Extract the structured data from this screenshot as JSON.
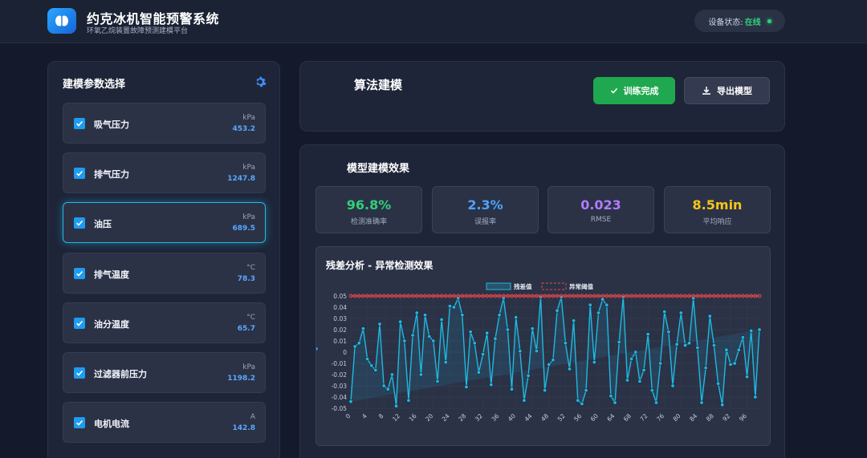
{
  "header": {
    "title": "约克冰机智能预警系统",
    "subtitle": "环氧乙烷装置故障预测建模平台",
    "status_label": "设备状态:",
    "status_value": "在线"
  },
  "left_panel": {
    "title": "建模参数选择",
    "params": [
      {
        "name": "吸气压力",
        "unit": "kPa",
        "value": "453.2",
        "checked": true
      },
      {
        "name": "排气压力",
        "unit": "kPa",
        "value": "1247.8",
        "checked": true
      },
      {
        "name": "油压",
        "unit": "kPa",
        "value": "689.5",
        "checked": true,
        "active": true
      },
      {
        "name": "排气温度",
        "unit": "°C",
        "value": "78.3",
        "checked": true
      },
      {
        "name": "油分温度",
        "unit": "°C",
        "value": "65.7",
        "checked": true
      },
      {
        "name": "过滤器前压力",
        "unit": "kPa",
        "value": "1198.2",
        "checked": true
      },
      {
        "name": "电机电流",
        "unit": "A",
        "value": "142.8",
        "checked": true
      }
    ]
  },
  "algo": {
    "title": "算法建模",
    "train_label": "训练完成",
    "export_label": "导出模型"
  },
  "results": {
    "title": "模型建模效果",
    "metrics": [
      {
        "value": "96.8%",
        "label": "检测准确率",
        "color": "#2fd07a"
      },
      {
        "value": "2.3%",
        "label": "误报率",
        "color": "#4da3ff"
      },
      {
        "value": "0.023",
        "label": "RMSE",
        "color": "#b07cff"
      },
      {
        "value": "8.5min",
        "label": "平均响应",
        "color": "#f5c518"
      }
    ]
  },
  "chart_data": {
    "type": "line",
    "title": "残差分析 - 异常检测效果",
    "legend": [
      "残差值",
      "异常阈值"
    ],
    "legend_placement": "top-center",
    "grid": true,
    "ylim": [
      -0.05,
      0.05
    ],
    "yticks": [
      -0.05,
      -0.04,
      -0.03,
      -0.02,
      -0.01,
      0,
      0.01,
      0.02,
      0.03,
      0.04,
      0.05
    ],
    "xticks": [
      0,
      4,
      8,
      12,
      16,
      20,
      24,
      28,
      32,
      36,
      40,
      44,
      48,
      52,
      56,
      60,
      64,
      68,
      72,
      76,
      80,
      84,
      88,
      92,
      96
    ],
    "threshold": 0.05,
    "residual_color": "#1fb8e0",
    "threshold_color": "#e5484d",
    "x": [
      0,
      1,
      2,
      3,
      4,
      5,
      6,
      7,
      8,
      9,
      10,
      11,
      12,
      13,
      14,
      15,
      16,
      17,
      18,
      19,
      20,
      21,
      22,
      23,
      24,
      25,
      26,
      27,
      28,
      29,
      30,
      31,
      32,
      33,
      34,
      35,
      36,
      37,
      38,
      39,
      40,
      41,
      42,
      43,
      44,
      45,
      46,
      47,
      48,
      49,
      50,
      51,
      52,
      53,
      54,
      55,
      56,
      57,
      58,
      59,
      60,
      61,
      62,
      63,
      64,
      65,
      66,
      67,
      68,
      69,
      70,
      71,
      72,
      73,
      74,
      75,
      76,
      77,
      78,
      79,
      80,
      81,
      82,
      83,
      84,
      85,
      86,
      87,
      88,
      89,
      90,
      91,
      92,
      93,
      94,
      95,
      96,
      97,
      98,
      99
    ],
    "series": [
      {
        "name": "残差值",
        "values": [
          -0.044,
          0.005,
          0.008,
          0.021,
          -0.006,
          -0.012,
          -0.016,
          0.025,
          -0.03,
          -0.033,
          -0.02,
          -0.048,
          0.027,
          0.01,
          -0.043,
          0.015,
          0.035,
          -0.02,
          0.033,
          0.014,
          0.01,
          -0.026,
          0.029,
          -0.009,
          0.041,
          0.04,
          0.048,
          0.033,
          -0.031,
          0.018,
          0.008,
          -0.018,
          -0.002,
          0.017,
          -0.029,
          0.012,
          0.033,
          0.048,
          0.02,
          -0.033,
          0.031,
          0.001,
          -0.043,
          -0.021,
          0.021,
          0.001,
          0.049,
          -0.034,
          -0.011,
          -0.007,
          0.037,
          0.049,
          0.008,
          -0.015,
          0.028,
          -0.043,
          -0.046,
          -0.034,
          0.042,
          -0.009,
          0.035,
          0.047,
          0.042,
          -0.039,
          -0.045,
          0.009,
          0.049,
          -0.025,
          -0.006,
          0.0,
          -0.026,
          -0.016,
          0.016,
          -0.034,
          -0.045,
          -0.01,
          0.036,
          0.018,
          -0.03,
          0.007,
          0.035,
          0.006,
          0.008,
          0.048,
          0.004,
          -0.045,
          -0.014,
          0.032,
          0.006,
          -0.028,
          -0.047,
          0.002,
          -0.011,
          -0.01,
          0.002,
          0.013,
          -0.022,
          0.019,
          -0.04,
          0.02,
          0.003
        ]
      },
      {
        "name": "异常阈值",
        "values": [
          0.05
        ]
      }
    ]
  }
}
